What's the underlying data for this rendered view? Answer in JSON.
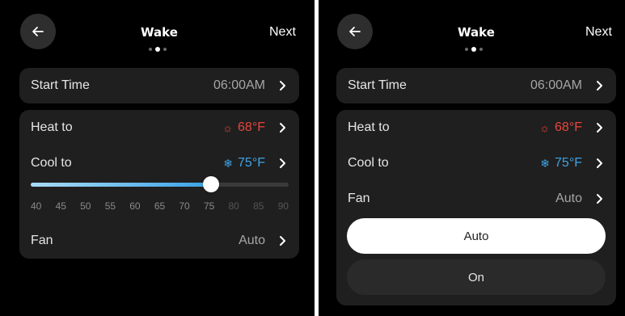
{
  "colors": {
    "heat": "#e8453c",
    "cool": "#3fa3e6",
    "background": "#000000",
    "card": "#1f1f1f"
  },
  "left": {
    "header": {
      "title": "Wake",
      "next_label": "Next",
      "back_icon": "arrow-left-icon",
      "page_indicator": {
        "total": 3,
        "active": 2
      }
    },
    "start_time": {
      "label": "Start Time",
      "value": "06:00AM"
    },
    "heat_to": {
      "label": "Heat to",
      "icon": "sun-icon",
      "icon_glyph": "☼",
      "value": "68°F"
    },
    "cool_to": {
      "label": "Cool to",
      "icon": "snowflake-icon",
      "icon_glyph": "❄",
      "value": "75°F"
    },
    "slider": {
      "min": 40,
      "max": 90,
      "value": 75,
      "ticks": [
        "40",
        "45",
        "50",
        "55",
        "60",
        "65",
        "70",
        "75",
        "80",
        "85",
        "90"
      ]
    },
    "fan": {
      "label": "Fan",
      "value": "Auto"
    }
  },
  "right": {
    "header": {
      "title": "Wake",
      "next_label": "Next",
      "back_icon": "arrow-left-icon",
      "page_indicator": {
        "total": 3,
        "active": 2
      }
    },
    "start_time": {
      "label": "Start Time",
      "value": "06:00AM"
    },
    "heat_to": {
      "label": "Heat to",
      "icon": "sun-icon",
      "icon_glyph": "☼",
      "value": "68°F"
    },
    "cool_to": {
      "label": "Cool to",
      "icon": "snowflake-icon",
      "icon_glyph": "❄",
      "value": "75°F"
    },
    "fan": {
      "label": "Fan",
      "value": "Auto"
    },
    "fan_options": [
      {
        "label": "Auto",
        "selected": true
      },
      {
        "label": "On",
        "selected": false
      }
    ]
  }
}
